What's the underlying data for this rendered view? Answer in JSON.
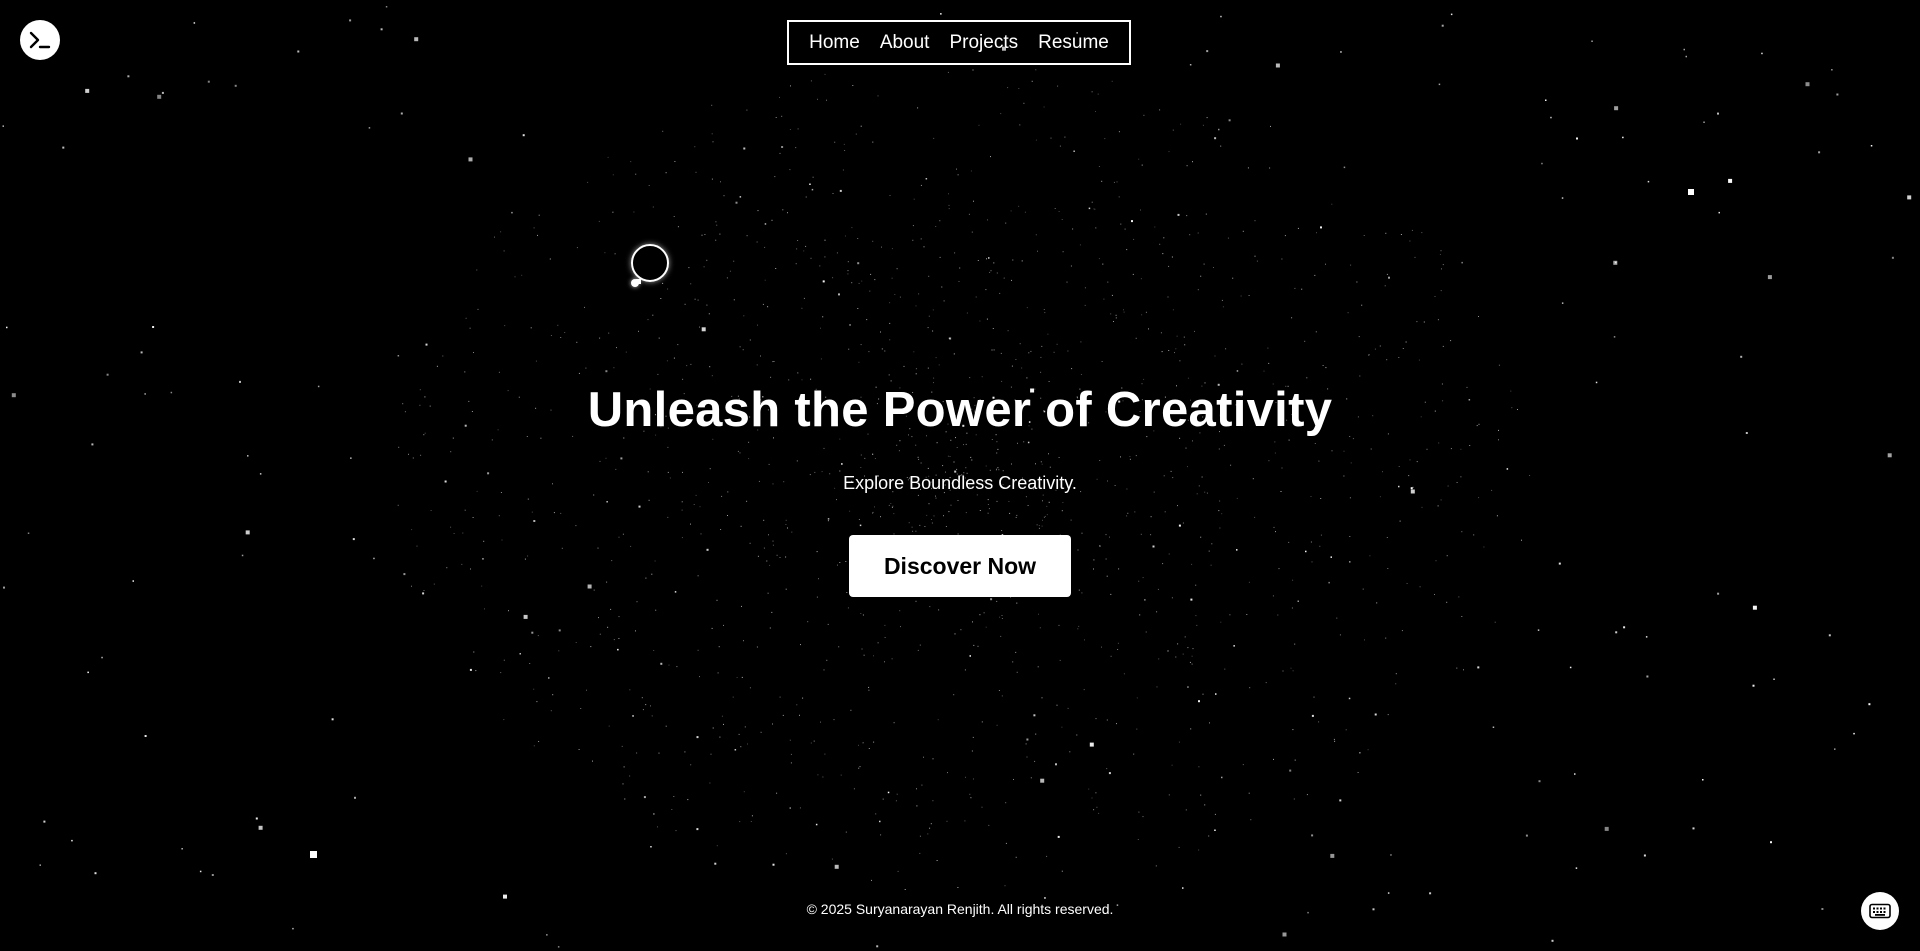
{
  "nav": {
    "items": [
      {
        "label": "Home"
      },
      {
        "label": "About"
      },
      {
        "label": "Projects"
      },
      {
        "label": "Resume"
      }
    ]
  },
  "logo": {
    "icon": "terminal-prompt-icon"
  },
  "hero": {
    "title": "Unleash the Power of Creativity",
    "subtitle": "Explore Boundless Creativity.",
    "cta_label": "Discover Now"
  },
  "footer": {
    "text": "© 2025 Suryanarayan Renjith. All rights reserved."
  },
  "keyboard_button": {
    "icon": "keyboard-icon"
  },
  "colors": {
    "background": "#000000",
    "foreground": "#ffffff",
    "button_text": "#000000"
  }
}
